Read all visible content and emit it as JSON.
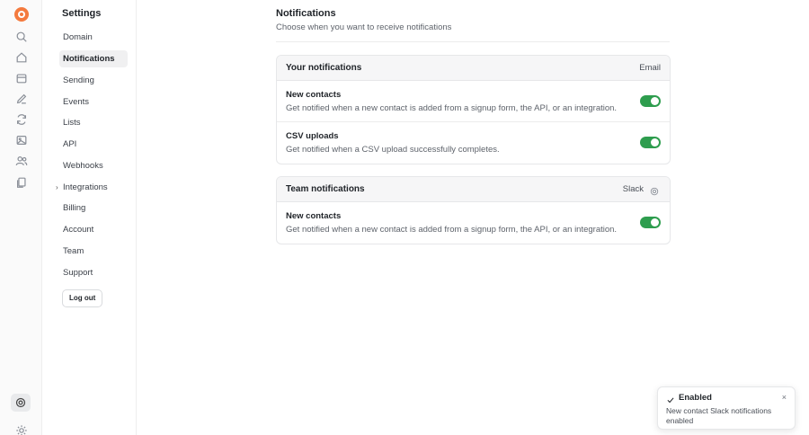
{
  "rail": {
    "icons": [
      "logo-icon",
      "search-icon",
      "home-icon",
      "inbox-icon",
      "edit-icon",
      "refresh-icon",
      "image-icon",
      "users-icon",
      "files-icon",
      "help-icon",
      "sun-icon"
    ]
  },
  "settings_nav": {
    "title": "Settings",
    "items": [
      {
        "label": "Domain",
        "active": false
      },
      {
        "label": "Notifications",
        "active": true
      },
      {
        "label": "Sending",
        "active": false
      },
      {
        "label": "Events",
        "active": false
      },
      {
        "label": "Lists",
        "active": false
      },
      {
        "label": "API",
        "active": false
      },
      {
        "label": "Webhooks",
        "active": false
      },
      {
        "label": "Integrations",
        "active": false,
        "expandable": true
      },
      {
        "label": "Billing",
        "active": false
      },
      {
        "label": "Account",
        "active": false
      },
      {
        "label": "Team",
        "active": false
      },
      {
        "label": "Support",
        "active": false
      }
    ],
    "logout_label": "Log out"
  },
  "main": {
    "title": "Notifications",
    "subtitle": "Choose when you want to receive notifications",
    "your_notifications": {
      "title": "Your notifications",
      "channel": "Email",
      "rows": [
        {
          "title": "New contacts",
          "description": "Get notified when a new contact is added from a signup form, the API, or an integration.",
          "enabled": true
        },
        {
          "title": "CSV uploads",
          "description": "Get notified when a CSV upload successfully completes.",
          "enabled": true
        }
      ]
    },
    "team_notifications": {
      "title": "Team notifications",
      "channel": "Slack",
      "rows": [
        {
          "title": "New contacts",
          "description": "Get notified when a new contact is added from a signup form, the API, or an integration.",
          "enabled": true
        }
      ]
    }
  },
  "toast": {
    "title": "Enabled",
    "message": "New contact Slack notifications enabled",
    "close_glyph": "×"
  },
  "colors": {
    "accent_green": "#2e9d4e",
    "logo_orange": "#f47a3e"
  }
}
